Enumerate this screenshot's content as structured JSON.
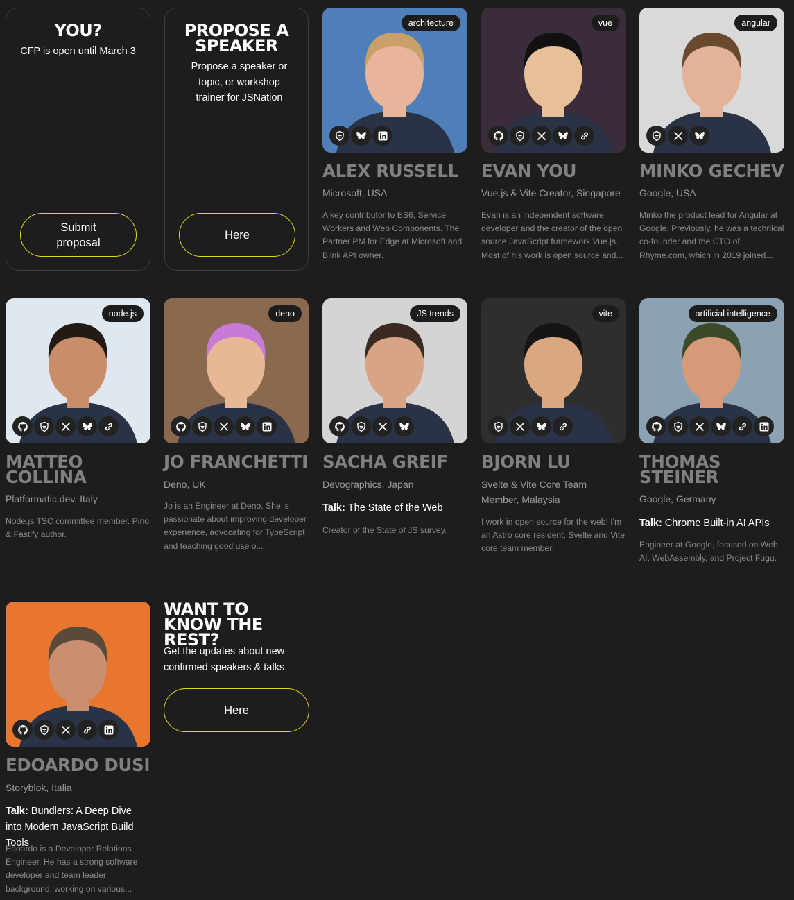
{
  "cta_cfp": {
    "title": "YOU?",
    "text": "CFP is open until March 3",
    "button": "Submit proposal"
  },
  "cta_propose": {
    "title": "PROPOSE A SPEAKER",
    "text": "Propose a speaker or topic, or workshop trainer for JSNation",
    "button": "Here"
  },
  "cta_updates": {
    "title": "WANT TO KNOW THE REST?",
    "text": "Get the updates about new confirmed speakers & talks",
    "button": "Here"
  },
  "talk_prefix": "Talk:",
  "speakers": [
    {
      "name": "ALEX RUSSELL",
      "tag": "architecture",
      "company": "Microsoft, USA",
      "talk": "",
      "bio": "A key contributor to ES6, Service Workers and Web Components. The Partner PM for Edge at Microsoft and Blink API owner.",
      "socials": [
        "shield-icon",
        "bluesky-icon",
        "linkedin-icon"
      ],
      "bg": "#4f7fb8",
      "skin": "#e8b59a",
      "hair": "#c9a06a"
    },
    {
      "name": "EVAN YOU",
      "tag": "vue",
      "company": "Vue.js & Vite Creator, Singapore",
      "talk": "",
      "bio": "Evan is an independent software developer and the creator of the open source JavaScript framework Vue.js. Most of his work is open source and...",
      "socials": [
        "github-icon",
        "shield-icon",
        "x-icon",
        "bluesky-icon",
        "link-icon"
      ],
      "bg": "#3a2c3a",
      "skin": "#e7c09a",
      "hair": "#111111"
    },
    {
      "name": "MINKO GECHEV",
      "tag": "angular",
      "company": "Google, USA",
      "talk": "",
      "bio": "Minko the product lead for Angular at Google. Previously, he was a technical co-founder and the CTO of Rhyme.com, which in 2019 joined...",
      "socials": [
        "shield-icon",
        "x-icon",
        "bluesky-icon"
      ],
      "bg": "#d9d9d9",
      "skin": "#e3b298",
      "hair": "#6a4a2e"
    },
    {
      "name": "MATTEO\nCOLLINA",
      "tag": "node.js",
      "company": "Platformatic.dev, Italy",
      "talk": "",
      "bio": "Node.js TSC committee member. Pino & Fastify author.",
      "socials": [
        "github-icon",
        "shield-icon",
        "x-icon",
        "bluesky-icon",
        "link-icon"
      ],
      "bg": "#dfe8ef",
      "skin": "#c98d6a",
      "hair": "#241a14"
    },
    {
      "name": "JO FRANCHETTI",
      "tag": "deno",
      "company": "Deno, UK",
      "talk": "",
      "bio": "Jo is an Engineer at Deno. She is passionate about improving developer experience, advocating for TypeScript and teaching good use o...",
      "socials": [
        "github-icon",
        "shield-icon",
        "x-icon",
        "bluesky-icon",
        "linkedin-icon"
      ],
      "bg": "#8a6a4e",
      "skin": "#e8b896",
      "hair": "#c77ad6"
    },
    {
      "name": "SACHA GREIF",
      "tag": "JS trends",
      "company": "Devographics, Japan",
      "talk": "The State of the Web",
      "bio": "Creator of the State of JS survey.",
      "socials": [
        "github-icon",
        "shield-icon",
        "x-icon",
        "bluesky-icon"
      ],
      "bg": "#d4d4d4",
      "skin": "#d8a487",
      "hair": "#3a2a20"
    },
    {
      "name": "BJORN LU",
      "tag": "vite",
      "company": "Svelte & Vite Core Team Member, Malaysia",
      "talk": "",
      "bio": "I work in open source for the web! I'm an Astro core resident, Svelte and Vite core team member.",
      "socials": [
        "shield-icon",
        "x-icon",
        "bluesky-icon",
        "link-icon"
      ],
      "bg": "#2e2e2e",
      "skin": "#d9a880",
      "hair": "#151515"
    },
    {
      "name": "THOMAS\nSTEINER",
      "tag": "artificial intelligence",
      "company": "Google, Germany",
      "talk": "Chrome Built-in AI APIs",
      "bio": "Engineer at Google, focused on Web AI, WebAssembly, and Project Fugu.",
      "socials": [
        "github-icon",
        "shield-icon",
        "x-icon",
        "bluesky-icon",
        "link-icon",
        "linkedin-icon"
      ],
      "bg": "#8aa2b4",
      "skin": "#d69a78",
      "hair": "#3d4a2a"
    },
    {
      "name": "EDOARDO DUSI",
      "tag": "",
      "company": "Storyblok, Italia",
      "talk": "Bundlers: A Deep Dive into Modern JavaScript Build Tools",
      "bio": "Edoardo is a Developer Relations Engineer. He has a strong software developer and team leader background, working on various...",
      "socials": [
        "github-icon",
        "shield-icon",
        "x-icon",
        "link-icon",
        "linkedin-icon"
      ],
      "bg": "#e8762e",
      "skin": "#c98f70",
      "hair": "#5a4a3a"
    }
  ]
}
